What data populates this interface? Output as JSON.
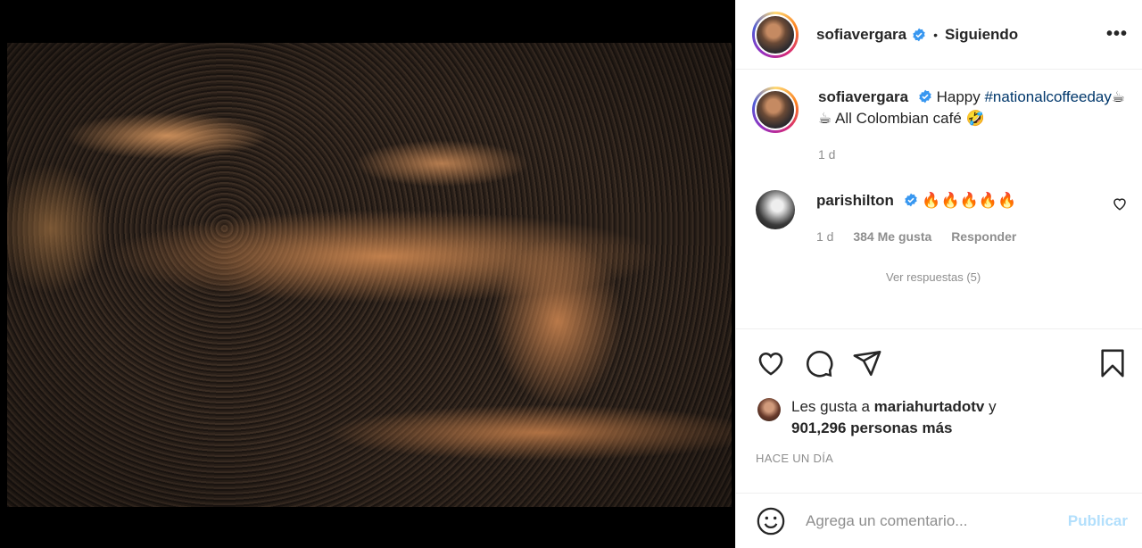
{
  "post": {
    "username": "sofiavergara",
    "follow_status": "Siguiendo",
    "more_label": "•••",
    "caption_prefix": "Happy",
    "caption_hashtag": "#nationalcoffeeday",
    "caption_emoji": "☕☕",
    "caption_rest": "All Colombian café",
    "caption_end_emoji": "🤣",
    "caption_age": "1 d"
  },
  "comment": {
    "username": "parishilton",
    "text": "🔥🔥🔥🔥🔥",
    "age": "1 d",
    "likes": "384 Me gusta",
    "reply_label": "Responder",
    "view_replies": "Ver respuestas (5)"
  },
  "likes": {
    "prefix": "Les gusta a",
    "user": "mariahurtadotv",
    "conj": "y",
    "count": "901,296 personas más"
  },
  "timestamp": "HACE UN DÍA",
  "input": {
    "placeholder": "Agrega un comentario...",
    "publish_label": "Publicar"
  },
  "colors": {
    "verified": "#3897f0",
    "link": "#00376b",
    "publish": "#b2dffc",
    "muted": "#8e8e8e"
  },
  "icons": [
    "verified-badge-icon",
    "heart-icon",
    "comment-icon",
    "share-icon",
    "bookmark-icon",
    "smiley-icon",
    "more-options-icon"
  ]
}
